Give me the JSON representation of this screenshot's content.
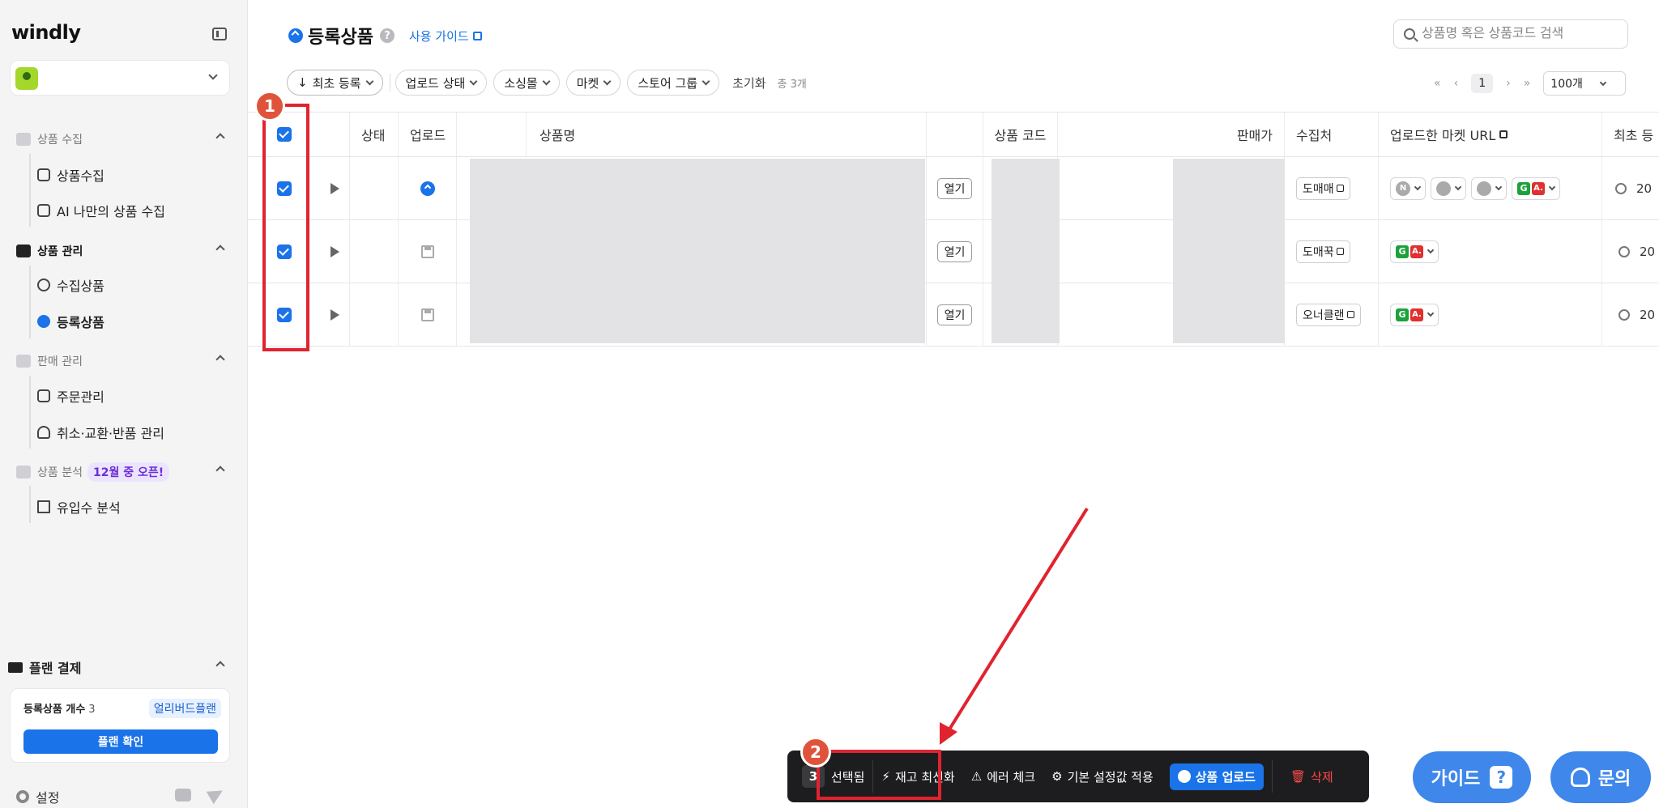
{
  "brand": "windly",
  "sidebar": {
    "sections": [
      {
        "label": "상품 수집",
        "items": [
          "상품수집",
          "AI 나만의 상품 수집"
        ]
      },
      {
        "label": "상품 관리",
        "items": [
          "수집상품",
          "등록상품"
        ]
      },
      {
        "label": "판매 관리",
        "items": [
          "주문관리",
          "취소·교환·반품 관리"
        ]
      },
      {
        "label": "상품 분석",
        "badge": "12월 중 오픈!",
        "items": [
          "유입수 분석"
        ]
      }
    ],
    "plan": {
      "title": "플랜 결제",
      "count_label": "등록상품 개수",
      "count_value": "3",
      "plan_tag": "얼리버드플랜",
      "button": "플랜 확인"
    },
    "settings": "설정"
  },
  "header": {
    "title": "등록상품",
    "help": "?",
    "guide_link": "사용 가이드",
    "search_placeholder": "상품명 혹은 상품코드 검색"
  },
  "filters": {
    "sort": "최초 등록",
    "pills": [
      "업로드 상태",
      "소싱몰",
      "마켓",
      "스토어 그룹"
    ],
    "reset": "초기화",
    "total": "총 3개"
  },
  "pager": {
    "first": "«",
    "prev": "‹",
    "current": "1",
    "next": "›",
    "last": "»",
    "page_size": "100개"
  },
  "table": {
    "headers": [
      "상태",
      "업로드",
      "상품명",
      "상품 코드",
      "판매가",
      "수집처",
      "업로드한 마켓 URL",
      "최초 등"
    ],
    "rows": [
      {
        "open": "열기",
        "source": "도매매",
        "upload": "uploaded",
        "date": "20"
      },
      {
        "open": "열기",
        "source": "도매꾹",
        "upload": "saved",
        "date": "20"
      },
      {
        "open": "열기",
        "source": "오너클랜",
        "upload": "saved",
        "date": "20"
      }
    ],
    "market_icons": {
      "n": "N",
      "g": "G",
      "a": "A."
    }
  },
  "actionbar": {
    "count": "3",
    "selected": "선택됨",
    "refresh": "재고 최신화",
    "error_check": "에러 체크",
    "apply_default": "기본 설정값 적용",
    "upload": "상품 업로드",
    "delete": "삭제"
  },
  "annotations": {
    "step1": "1",
    "step2": "2"
  },
  "floating": {
    "guide": "가이드",
    "inquiry": "문의"
  },
  "colors": {
    "accent": "#1a73e8",
    "annotation_red": "#e0242f",
    "marker_orange": "#e0533b"
  }
}
